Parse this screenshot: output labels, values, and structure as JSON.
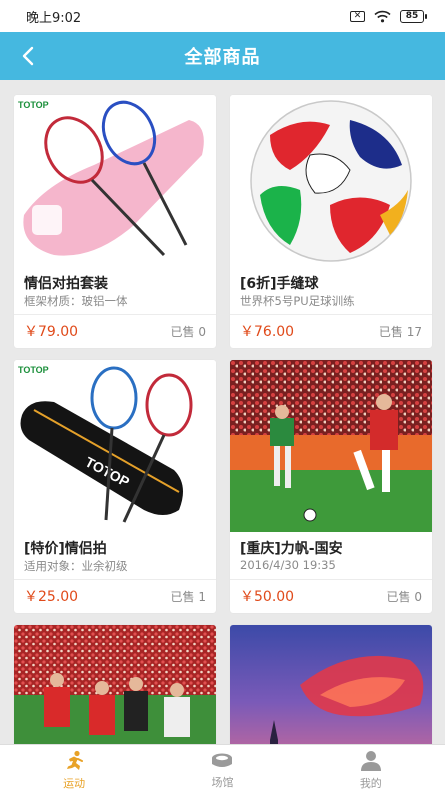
{
  "status_bar": {
    "time": "晚上9:02",
    "sim_badge": "✕",
    "battery_level": "85"
  },
  "header": {
    "title": "全部商品",
    "back_icon": "chevron-left-icon"
  },
  "products": [
    {
      "name": "情侣对拍套装",
      "desc": "框架材质：玻铝一体",
      "price": "￥79.00",
      "sold": "已售 0",
      "image": "badminton-racket-pair-pink-bag"
    },
    {
      "name": "[6折]手缝球",
      "desc": "世界杯5号PU足球训练",
      "price": "￥76.00",
      "sold": "已售 17",
      "image": "soccer-ball"
    },
    {
      "name": "[特价]情侣拍",
      "desc": "适用对象：业余初级",
      "price": "￥25.00",
      "sold": "已售 1",
      "image": "badminton-racket-pair-black-bag"
    },
    {
      "name": "[重庆]力帆-国安",
      "desc": "2016/4/30 19:35",
      "price": "￥50.00",
      "sold": "已售 0",
      "image": "football-match-photo"
    },
    {
      "image": "football-players-crowd-photo"
    },
    {
      "image": "sunset-sky-photo"
    }
  ],
  "tabs": [
    {
      "label": "运动",
      "icon": "running-man-icon",
      "active": true
    },
    {
      "label": "场馆",
      "icon": "stadium-icon",
      "active": false
    },
    {
      "label": "我的",
      "icon": "user-icon",
      "active": false
    }
  ],
  "colors": {
    "header": "#45b8e0",
    "price": "#e04a1a",
    "tab_active": "#e8a227",
    "tab_inactive": "#9a9a9a"
  },
  "brand_text": {
    "racket_brand": "TOTOP"
  }
}
